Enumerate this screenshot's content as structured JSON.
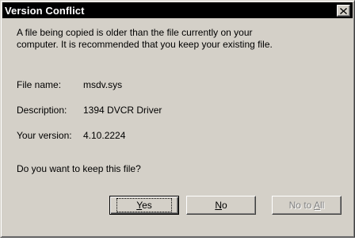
{
  "window": {
    "title": "Version Conflict"
  },
  "message": {
    "line1": "A file being copied is older than the file currently on your",
    "line2": "computer. It is recommended that you keep your existing file."
  },
  "fields": [
    {
      "label": "File name:",
      "value": "msdv.sys"
    },
    {
      "label": "Description:",
      "value": "1394 DVCR Driver"
    },
    {
      "label": "Your version:",
      "value": "4.10.2224"
    }
  ],
  "question": "Do you want to keep this file?",
  "buttons": {
    "yes": {
      "label": "Yes",
      "accel": "Y",
      "rest": "es"
    },
    "no": {
      "label": "No",
      "accel": "N",
      "rest": "o"
    },
    "no_to_all": {
      "label": "No to All",
      "prefix": "No to ",
      "accel": "A",
      "rest": "ll",
      "disabled": true
    }
  },
  "colors": {
    "face": "#d4d0c8",
    "title_bar": "#000000",
    "title_text": "#ffffff",
    "disabled_text": "#808080"
  }
}
